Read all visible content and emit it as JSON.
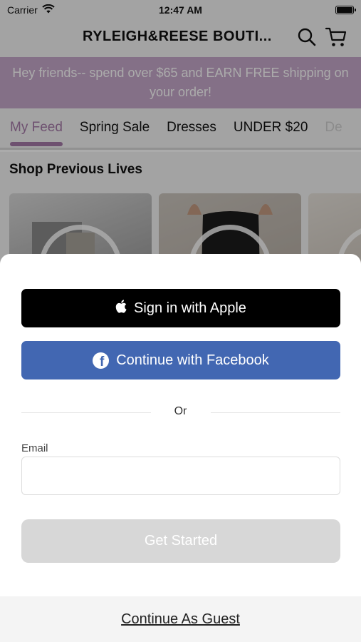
{
  "status_bar": {
    "carrier": "Carrier",
    "time": "12:47 AM"
  },
  "header": {
    "store_title": "RYLEIGH&REESE BOUTI...",
    "icons": [
      "search-icon",
      "cart-icon"
    ]
  },
  "banner": {
    "text": "Hey friends-- spend over $65 and EARN FREE shipping on your order!",
    "color": "#c5a7c9"
  },
  "tabs": [
    {
      "label": "My Feed",
      "active": true
    },
    {
      "label": "Spring Sale",
      "active": false
    },
    {
      "label": "Dresses",
      "active": false
    },
    {
      "label": "UNDER $20",
      "active": false
    },
    {
      "label": "De",
      "active": false
    }
  ],
  "feed": {
    "section_title": "Shop Previous Lives"
  },
  "sheet": {
    "apple_button": "Sign in with Apple",
    "facebook_button": "Continue with Facebook",
    "divider_text": "Or",
    "email_label": "Email",
    "email_value": "",
    "email_placeholder": "",
    "get_started_button": "Get Started",
    "guest_link": "Continue As Guest"
  },
  "colors": {
    "accent": "#a57aa8",
    "facebook": "#4267b2",
    "apple": "#000000",
    "disabled_button": "#d7d7d7"
  }
}
